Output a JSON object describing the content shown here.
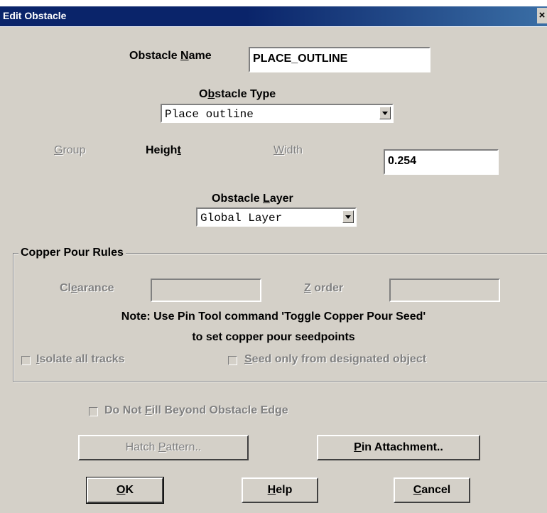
{
  "window": {
    "title": "Edit Obstacle",
    "close_glyph": "×"
  },
  "obstacle_name": {
    "label_pre": "Obstacle ",
    "label_u": "N",
    "label_post": "ame",
    "value": "PLACE_OUTLINE"
  },
  "obstacle_type": {
    "label_pre": "O",
    "label_u": "b",
    "label_post": "stacle Type",
    "selected": "Place outline"
  },
  "dimensions": {
    "group_u": "G",
    "group_rest": "roup",
    "height_pre": "Heigh",
    "height_u": "t",
    "width_u": "W",
    "width_rest": "idth",
    "value": "0.254"
  },
  "obstacle_layer": {
    "label_pre": "Obstacle ",
    "label_u": "L",
    "label_post": "ayer",
    "selected": "Global Layer"
  },
  "copper_pour": {
    "title": "Copper Pour Rules",
    "clearance_pre": "Cl",
    "clearance_u": "e",
    "clearance_post": "arance",
    "zorder_u": "Z",
    "zorder_post": " order",
    "note_line1": "Note: Use Pin Tool command 'Toggle Copper Pour Seed'",
    "note_line2": "to set copper pour seedpoints",
    "isolate_u": "I",
    "isolate_post": "solate all tracks",
    "seed_u": "S",
    "seed_post": "eed only from designated object"
  },
  "no_fill": {
    "pre": "Do Not ",
    "u": "F",
    "post": "ill Beyond Obstacle Edge"
  },
  "buttons": {
    "hatch_pre": "Hatch ",
    "hatch_u": "P",
    "hatch_post": "attern..",
    "pin_u": "P",
    "pin_post": "in Attachment..",
    "ok_u": "O",
    "ok_post": "K",
    "help_u": "H",
    "help_post": "elp",
    "cancel_u": "C",
    "cancel_post": "ancel"
  }
}
